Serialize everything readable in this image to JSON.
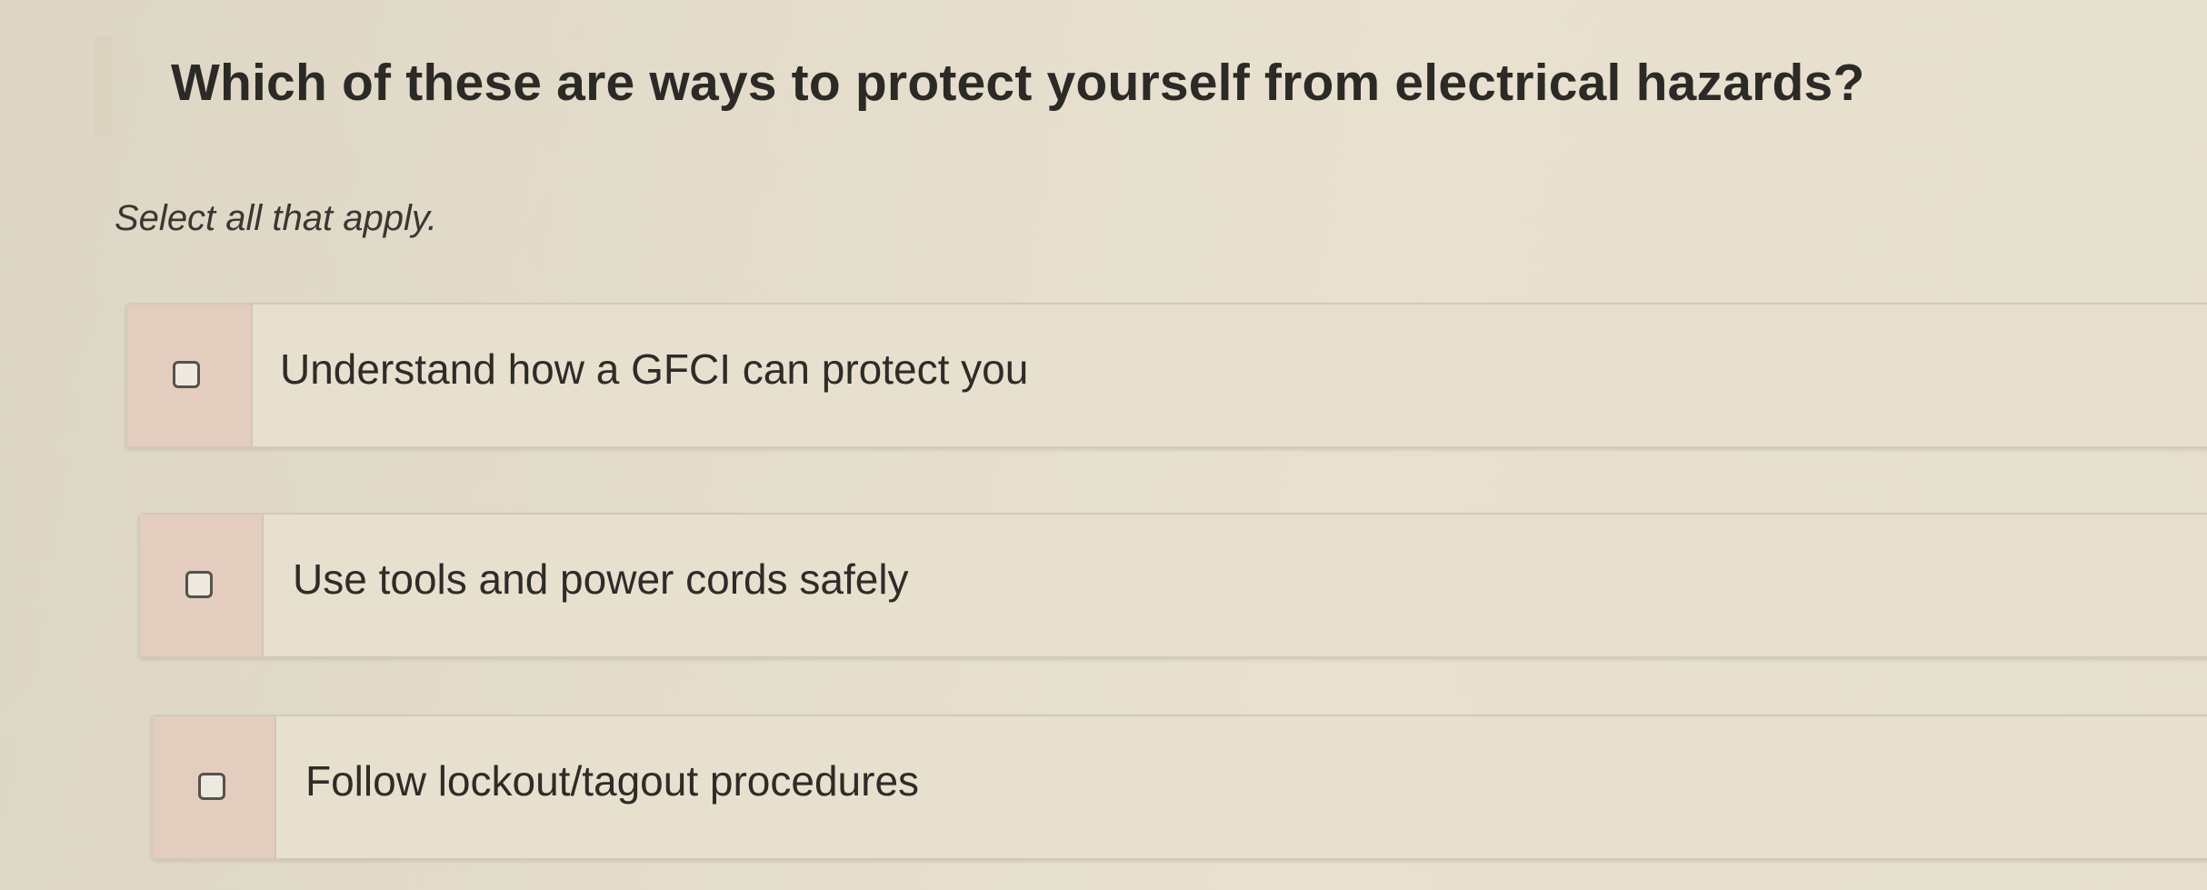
{
  "question": {
    "title": "Which of these are ways to protect yourself from electrical hazards?",
    "instruction": "Select all that apply."
  },
  "options": [
    {
      "label": "Understand how a GFCI can protect you",
      "checked": false
    },
    {
      "label": "Use tools and power cords safely",
      "checked": false
    },
    {
      "label": "Follow lockout/tagout procedures",
      "checked": false
    }
  ]
}
